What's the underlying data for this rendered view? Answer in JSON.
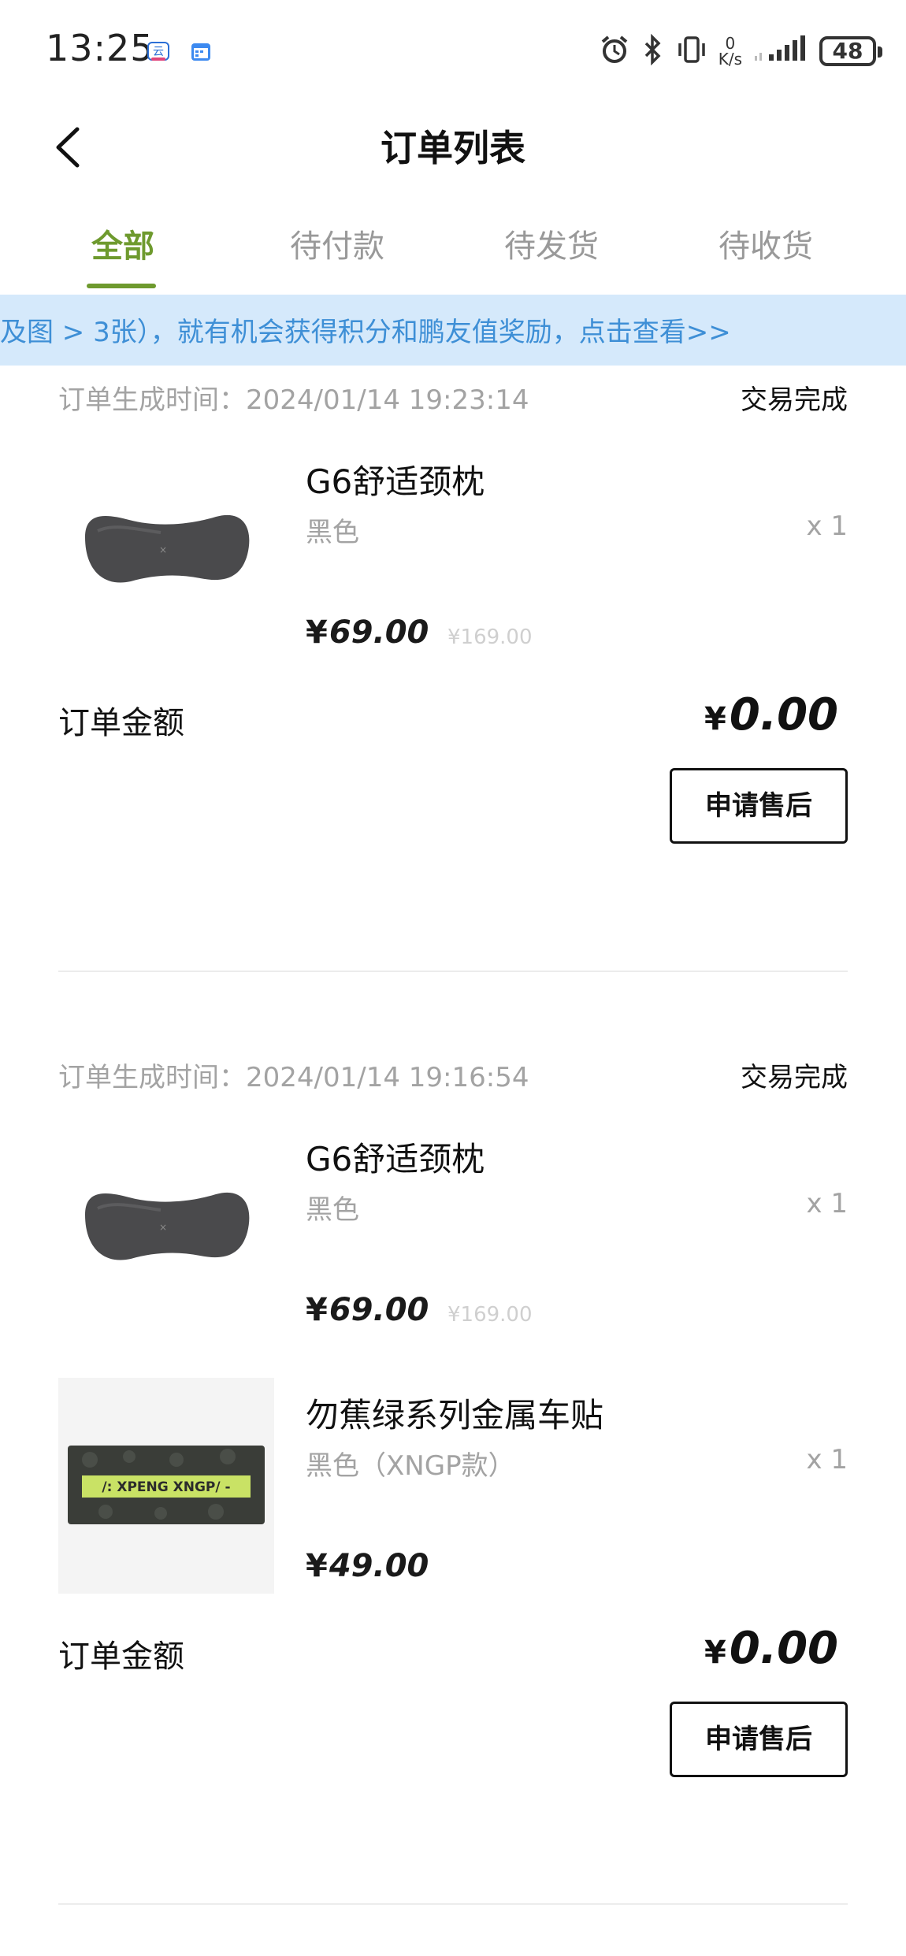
{
  "status_bar": {
    "time": "13:25",
    "net_speed_value": "0",
    "net_speed_unit": "K/s",
    "battery": "48"
  },
  "header": {
    "title": "订单列表"
  },
  "tabs": [
    {
      "label": "全部",
      "active": true
    },
    {
      "label": "待付款",
      "active": false
    },
    {
      "label": "待发货",
      "active": false
    },
    {
      "label": "待收货",
      "active": false
    }
  ],
  "banner": {
    "text": "及图 > 3张），就有机会获得积分和鹏友值奖励，点击查看>>"
  },
  "orders": [
    {
      "time": "订单生成时间：2024/01/14 19:23:14",
      "status": "交易完成",
      "items": [
        {
          "name": "G6舒适颈枕",
          "spec": "黑色",
          "qty": "x 1",
          "price": "69.00",
          "original_price": "¥169.00"
        }
      ],
      "total_label": "订单金额",
      "total": "0.00",
      "after_sale_label": "申请售后"
    },
    {
      "time": "订单生成时间：2024/01/14 19:16:54",
      "status": "交易完成",
      "items": [
        {
          "name": "G6舒适颈枕",
          "spec": "黑色",
          "qty": "x 1",
          "price": "69.00",
          "original_price": "¥169.00"
        },
        {
          "name": "勿蕉绿系列金属车贴",
          "spec": "黑色（XNGP款）",
          "qty": "x 1",
          "price": "49.00",
          "sticker_text": "/: XPENG XNGP/ -"
        }
      ],
      "total_label": "订单金额",
      "total": "0.00",
      "after_sale_label": "申请售后"
    }
  ],
  "currency_symbol": "¥",
  "colors": {
    "accent": "#6e9a2e",
    "banner_bg": "#d5e9fb",
    "banner_text": "#3e8fd6"
  }
}
